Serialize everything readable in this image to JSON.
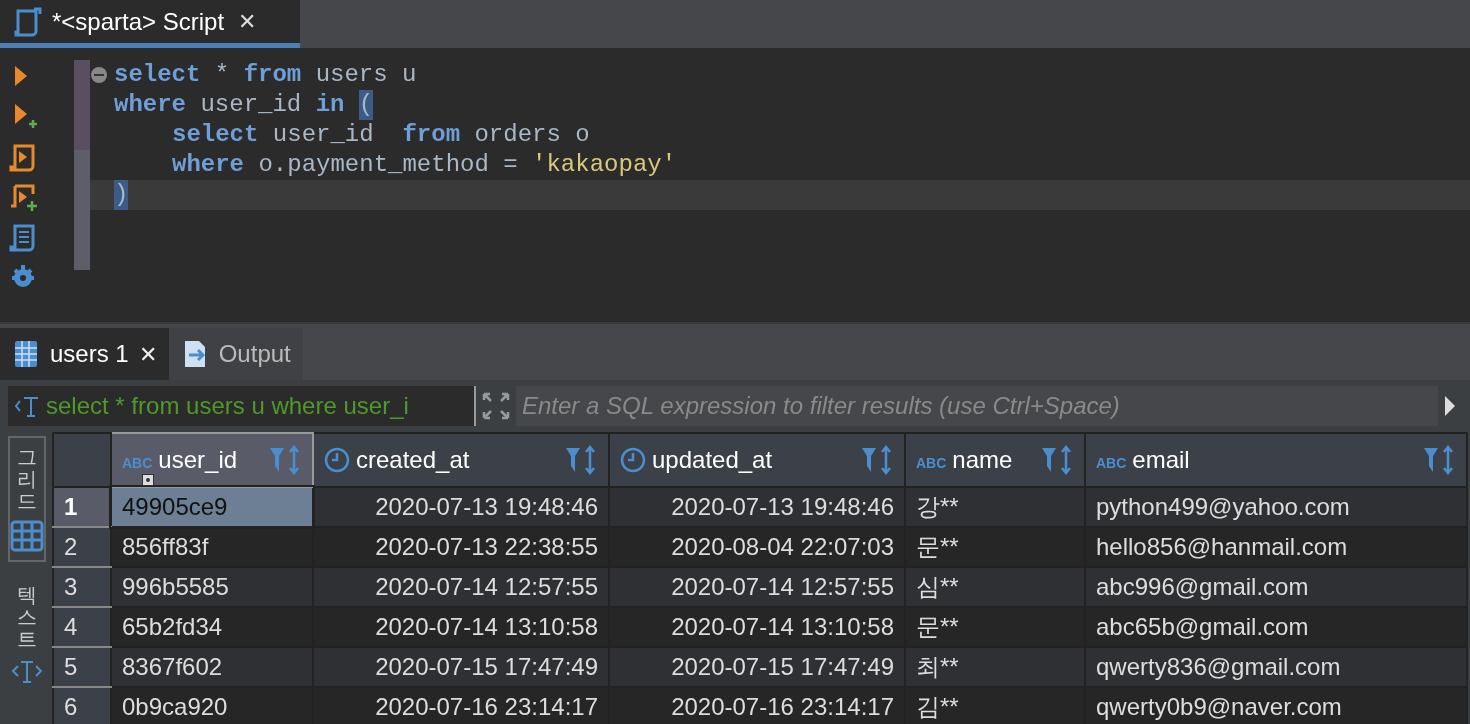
{
  "editor_tab": {
    "title": "*<sparta> Script",
    "close": "✕",
    "selected": true
  },
  "toolbar": [
    {
      "kind": "run"
    },
    {
      "kind": "run-new"
    },
    {
      "kind": "script"
    },
    {
      "kind": "script-new"
    },
    {
      "kind": "plan"
    },
    {
      "kind": "settings"
    }
  ],
  "editor": {
    "lines": [
      {
        "current": false,
        "fold": true,
        "tokens": [
          {
            "text": "select",
            "kind": "keyword"
          },
          {
            "text": " * ",
            "kind": "plain"
          },
          {
            "text": "from",
            "kind": "keyword"
          },
          {
            "text": " users u",
            "kind": "plain"
          }
        ]
      },
      {
        "current": false,
        "fold": false,
        "tokens": [
          {
            "text": "where",
            "kind": "keyword"
          },
          {
            "text": " user_id ",
            "kind": "plain"
          },
          {
            "text": "in ",
            "kind": "keyword"
          },
          {
            "text": "(",
            "kind": "match"
          }
        ],
        "children": [
          {
            "current": false,
            "fold": false,
            "tokens": [
              {
                "text": "select",
                "kind": "keyword"
              },
              {
                "text": " user_id  ",
                "kind": "plain"
              },
              {
                "text": "from",
                "kind": "keyword"
              },
              {
                "text": " orders o",
                "kind": "plain"
              }
            ]
          },
          {
            "current": false,
            "fold": false,
            "tokens": [
              {
                "text": "where",
                "kind": "keyword"
              },
              {
                "text": " o.payment_method = ",
                "kind": "plain"
              },
              {
                "text": "'kakaopay'",
                "kind": "string"
              }
            ]
          }
        ]
      },
      {
        "current": true,
        "fold": false,
        "tokens": [
          {
            "text": ")",
            "kind": "match"
          }
        ]
      }
    ]
  },
  "result_tabs": [
    {
      "label": "users 1",
      "close": "✕",
      "kind": "grid",
      "selected": true
    },
    {
      "label": "Output",
      "kind": "output",
      "selected": false
    }
  ],
  "filter": {
    "query": "select * from users u where user_i",
    "placeholder": "Enter a SQL expression to filter results (use Ctrl+Space)"
  },
  "view_tabs": [
    {
      "label": "그리드",
      "kind": "grid",
      "selected": true
    },
    {
      "label": "텍스트",
      "kind": "text",
      "selected": false
    }
  ],
  "table": {
    "columns": [
      {
        "label": "user_id",
        "kind": "text",
        "type_label": "ABC",
        "key": true,
        "selected": true
      },
      {
        "label": "created_at",
        "kind": "datetime",
        "key": false,
        "selected": false
      },
      {
        "label": "updated_at",
        "kind": "datetime",
        "key": false,
        "selected": false
      },
      {
        "label": "name",
        "kind": "text",
        "type_label": "ABC",
        "key": false,
        "selected": false
      },
      {
        "label": "email",
        "kind": "text",
        "type_label": "ABC",
        "key": false,
        "selected": false
      }
    ],
    "rows": [
      {
        "number": "1",
        "selected": true,
        "cells": [
          "49905ce9",
          "2020-07-13 19:48:46",
          "2020-07-13 19:48:46",
          "강**",
          "python499@yahoo.com"
        ]
      },
      {
        "number": "2",
        "selected": false,
        "cells": [
          "856ff83f",
          "2020-07-13 22:38:55",
          "2020-08-04 22:07:03",
          "문**",
          "hello856@hanmail.com"
        ]
      },
      {
        "number": "3",
        "selected": false,
        "cells": [
          "996b5585",
          "2020-07-14 12:57:55",
          "2020-07-14 12:57:55",
          "심**",
          "abc996@gmail.com"
        ]
      },
      {
        "number": "4",
        "selected": false,
        "cells": [
          "65b2fd34",
          "2020-07-14 13:10:58",
          "2020-07-14 13:10:58",
          "문**",
          "abc65b@gmail.com"
        ]
      },
      {
        "number": "5",
        "selected": false,
        "cells": [
          "8367f602",
          "2020-07-15 17:47:49",
          "2020-07-15 17:47:49",
          "최**",
          "qwerty836@gmail.com"
        ]
      },
      {
        "number": "6",
        "selected": false,
        "cells": [
          "0b9ca920",
          "2020-07-16 23:14:17",
          "2020-07-16 23:14:17",
          "김**",
          "qwerty0b9@naver.com"
        ]
      }
    ]
  }
}
